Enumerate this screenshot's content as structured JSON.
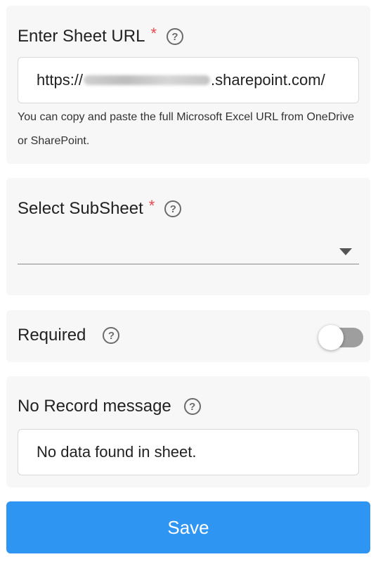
{
  "sheet_url": {
    "label": "Enter Sheet URL",
    "required_marker": "*",
    "value_prefix": "https://",
    "value_suffix": ".sharepoint.com/",
    "helper_text": "You can copy and paste the full Microsoft Excel URL from OneDrive or SharePoint."
  },
  "subsheet": {
    "label": "Select SubSheet",
    "required_marker": "*",
    "selected_value": ""
  },
  "required": {
    "label": "Required",
    "enabled": false
  },
  "no_record": {
    "label": "No Record message",
    "value": "No data found in sheet."
  },
  "help_glyph": "?",
  "save_label": "Save",
  "colors": {
    "accent": "#2f95f2",
    "required_star": "#e5484d",
    "card_bg": "#f7f7f7"
  }
}
